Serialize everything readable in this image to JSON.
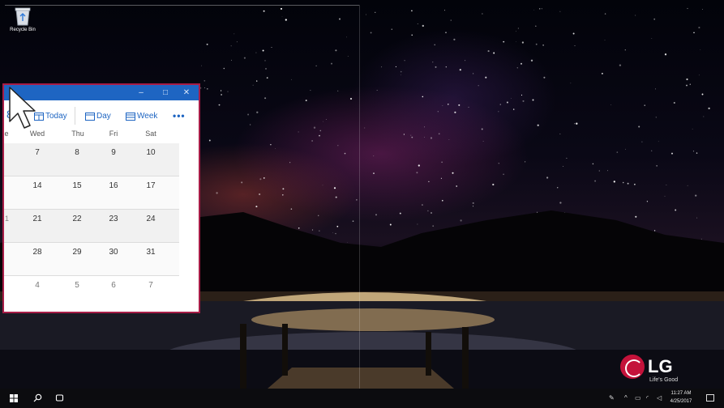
{
  "desktop": {
    "recycle_bin_label": "Recycle Bin"
  },
  "calendar_window": {
    "controls": {
      "minimize": "–",
      "maximize": "□",
      "close": "✕"
    },
    "toolbar": {
      "partial_glyph": "8",
      "today_label": "Today",
      "day_label": "Day",
      "week_label": "Week",
      "more_label": "•••"
    },
    "weekdays": [
      "Wed",
      "Thu",
      "Fri",
      "Sat"
    ],
    "weekday_edge": "e",
    "weeks": [
      {
        "days": [
          "7",
          "8",
          "9",
          "10"
        ]
      },
      {
        "days": [
          "14",
          "15",
          "16",
          "17"
        ]
      },
      {
        "days": [
          "21",
          "22",
          "23",
          "24"
        ]
      },
      {
        "days": [
          "28",
          "29",
          "30",
          "31"
        ]
      },
      {
        "days": [
          "4",
          "5",
          "6",
          "7"
        ]
      }
    ],
    "accent_color": "#1e65c2",
    "frame_color": "#a81d47"
  },
  "brand": {
    "logo_text": "LG",
    "tagline": "Life's Good"
  },
  "taskbar": {
    "clock_time": "11:27 AM",
    "clock_date": "4/25/2017"
  }
}
